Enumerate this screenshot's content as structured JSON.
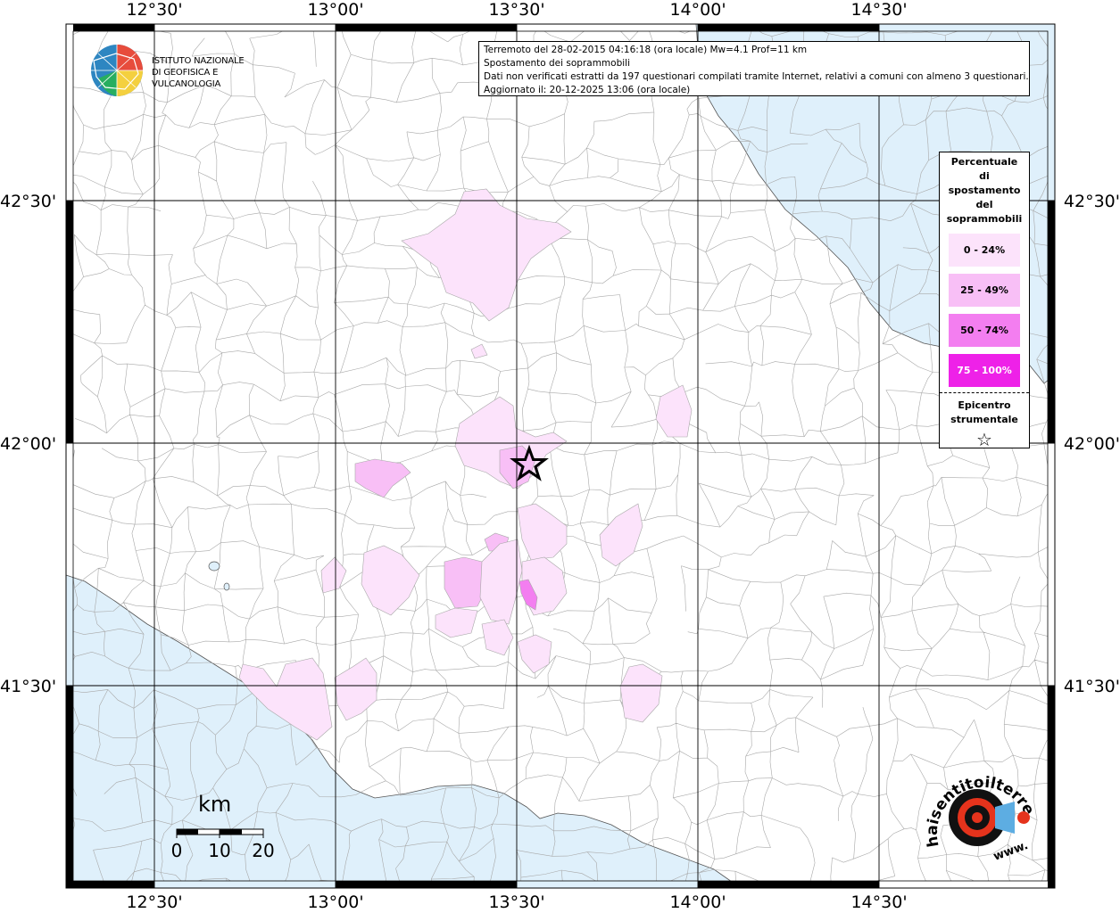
{
  "map": {
    "colors": {
      "sea": "#dff0fb",
      "land": "#ffffff",
      "boundary": "#a8a8a8",
      "grid": "#000000",
      "class_0_24": "#fce3fb",
      "class_25_49": "#f8bff6",
      "class_50_74": "#f37ef0",
      "class_75_100": "#ee21e8"
    },
    "lon_ticks": [
      "12°30'",
      "13°00'",
      "13°30'",
      "14°00'",
      "14°30'"
    ],
    "lat_ticks": [
      "42°30'",
      "42°00'",
      "41°30'"
    ],
    "epicenter_symbol": "star-icon"
  },
  "info": {
    "line1": "Terremoto del 28-02-2015 04:16:18 (ora locale) Mw=4.1 Prof=11 km",
    "line2": "Spostamento dei soprammobili",
    "line3": "Dati non verificati estratti da 197 questionari compilati tramite Internet, relativi a comuni con almeno 3 questionari.",
    "line4": "Aggiornato il: 20-12-2025 13:06 (ora locale)"
  },
  "logo": {
    "line1": "ISTITUTO NAZIONALE",
    "line2": "DI GEOFISICA E VULCANOLOGIA"
  },
  "legend": {
    "title_lines": [
      "Percentuale",
      "di",
      "spostamento",
      "del",
      "soprammobili"
    ],
    "items": [
      {
        "label": "0 - 24%",
        "color": "#fce3fb"
      },
      {
        "label": "25 - 49%",
        "color": "#f8bff6"
      },
      {
        "label": "50 - 74%",
        "color": "#f37ef0"
      },
      {
        "label": "75 - 100%",
        "color": "#ee21e8"
      }
    ],
    "epicenter_lines": [
      "Epicentro",
      "strumentale"
    ],
    "epicenter_symbol": "☆"
  },
  "scale": {
    "unit": "km",
    "ticks": [
      "0",
      "10",
      "20"
    ]
  },
  "hai_logo": {
    "text": "haisentitoilterremoto.it",
    "url_text": "www."
  }
}
